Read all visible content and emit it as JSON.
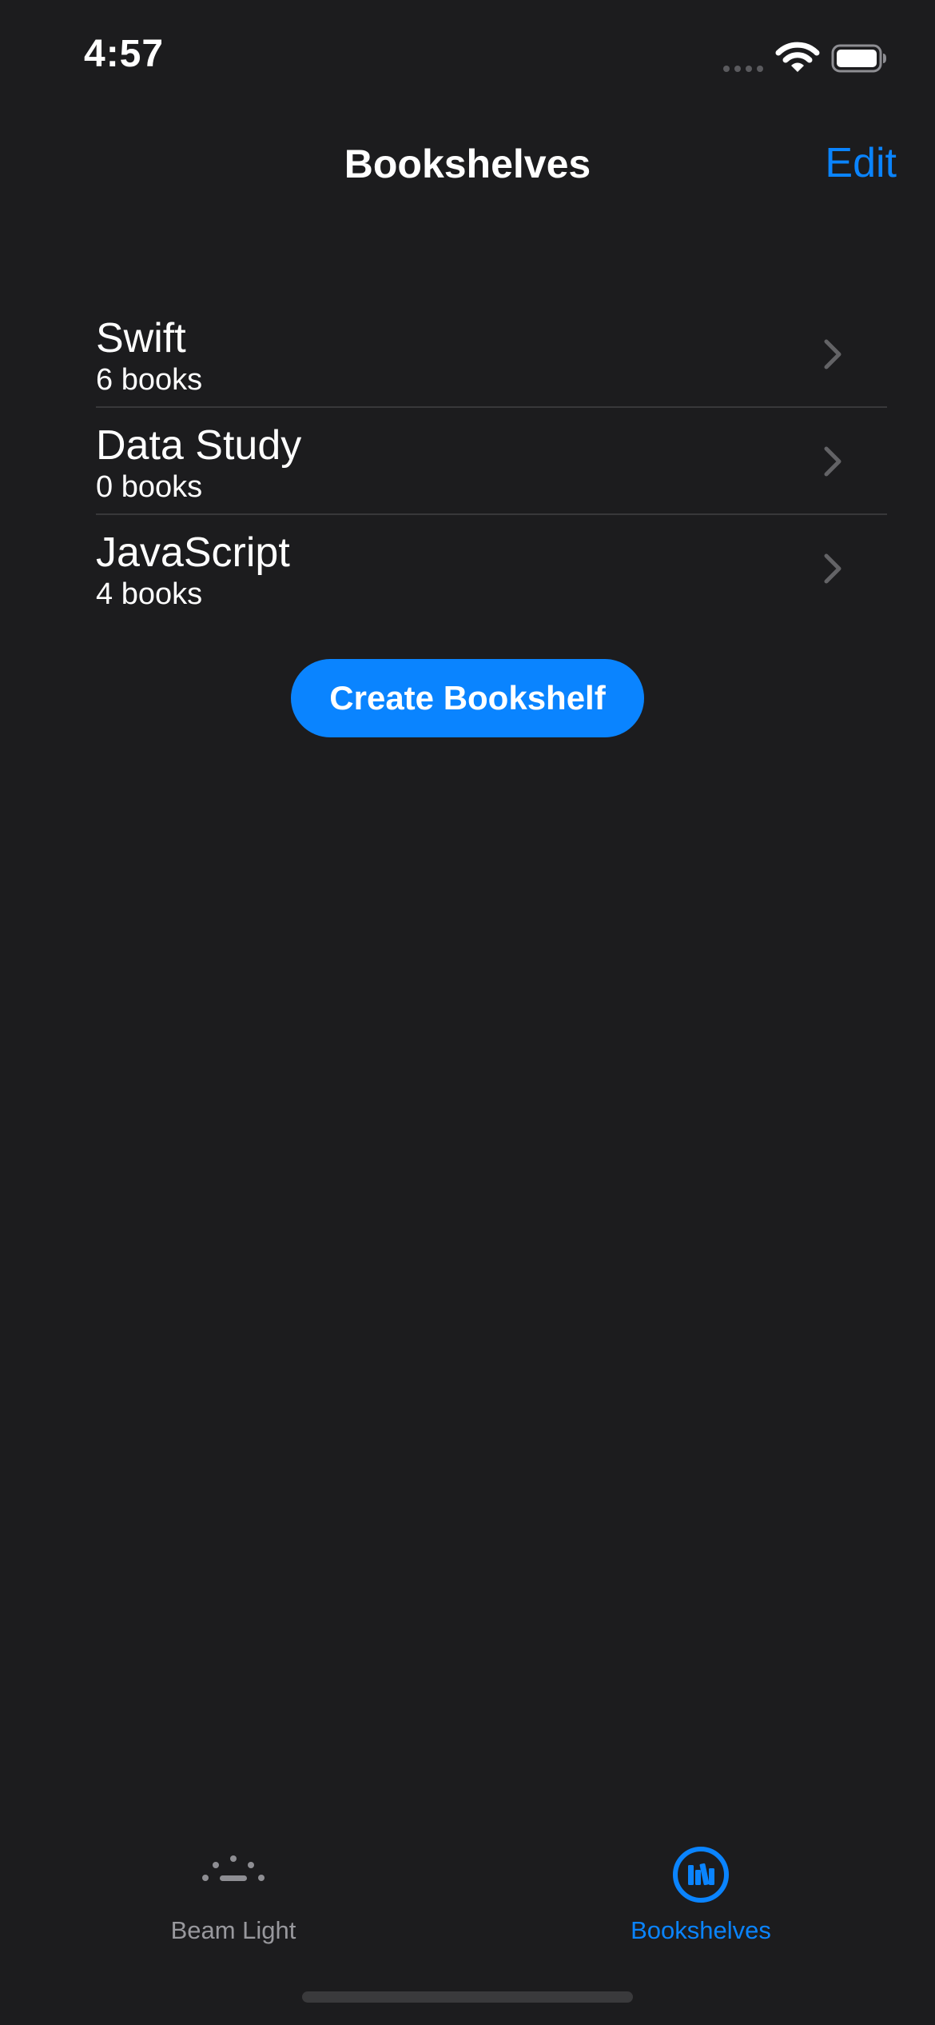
{
  "status_bar": {
    "time": "4:57"
  },
  "nav": {
    "title": "Bookshelves",
    "edit_label": "Edit"
  },
  "shelves": [
    {
      "name": "Swift",
      "count": "6 books"
    },
    {
      "name": "Data Study",
      "count": "0 books"
    },
    {
      "name": "JavaScript",
      "count": "4 books"
    }
  ],
  "create_button_label": "Create Bookshelf",
  "tab_bar": {
    "tabs": [
      {
        "label": "Beam Light",
        "icon": "beam-light-icon",
        "selected": false
      },
      {
        "label": "Bookshelves",
        "icon": "bookshelves-icon",
        "selected": true
      }
    ]
  },
  "colors": {
    "background": "#1c1c1e",
    "accent": "#0a84ff",
    "separator": "#38383a",
    "inactive": "#98989d"
  }
}
